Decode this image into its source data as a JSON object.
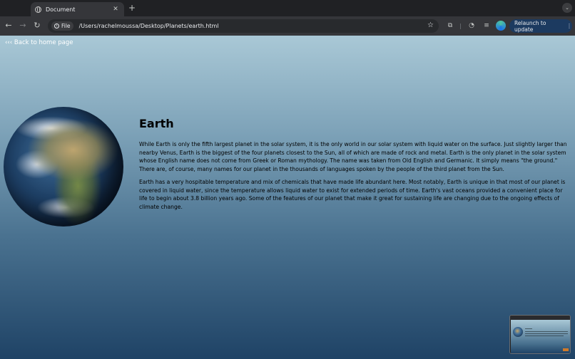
{
  "browser": {
    "tab": {
      "title": "Document",
      "close_glyph": "✕"
    },
    "new_tab_glyph": "+",
    "tab_search_glyph": "⌄",
    "nav": {
      "back_glyph": "←",
      "forward_glyph": "→",
      "reload_glyph": "↻"
    },
    "omnibox": {
      "chip_label": "File",
      "url": "/Users/rachelmoussa/Desktop/Planets/earth.html"
    },
    "relaunch_label": "Relaunch to update",
    "relaunch_menu_glyph": "⋮"
  },
  "page": {
    "back_link": "‹‹‹ Back to home page",
    "title": "Earth",
    "paragraphs": [
      "While Earth is only the fifth largest planet in the solar system, it is the only world in our solar system with liquid water on the surface. Just slightly larger than nearby Venus, Earth is the biggest of the four planets closest to the Sun, all of which are made of rock and metal. Earth is the only planet in the solar system whose English name does not come from Greek or Roman mythology. The name was taken from Old English and Germanic. It simply means \"the ground.\" There are, of course, many names for our planet in the thousands of languages spoken by the people of the third planet from the Sun.",
      "Earth has a very hospitable temperature and mix of chemicals that have made life abundant here. Most notably, Earth is unique in that most of our planet is covered in liquid water, since the temperature allows liquid water to exist for extended periods of time. Earth's vast oceans provided a convenient place for life to begin about 3.8 billion years ago. Some of the features of our planet that make it great for sustaining life are changing due to the ongoing effects of climate change."
    ]
  },
  "colors": {
    "browser_bg": "#202124",
    "toolbar_bg": "#35363a",
    "relaunch_bg": "#1c3a60",
    "page_gradient_top": "#a9c8d6",
    "page_gradient_bottom": "#1f4366"
  },
  "icons": {
    "tab_favicon": "globe-icon",
    "info": "info-icon",
    "bookmark": "star-icon",
    "extensions": "puzzle-icon",
    "performance": "gauge-icon",
    "media": "media-queue-icon",
    "profile": "profile-icon"
  }
}
